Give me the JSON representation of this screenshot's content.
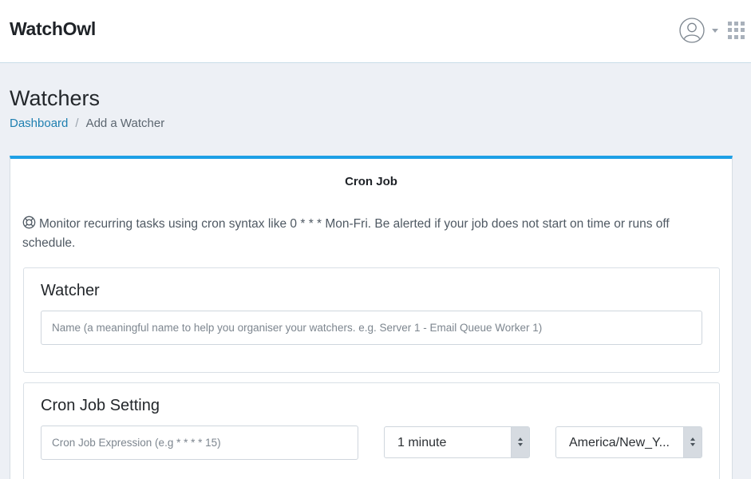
{
  "header": {
    "brand": "WatchOwl",
    "icons": [
      "user-avatar-icon",
      "caret-down-icon",
      "apps-grid-icon"
    ]
  },
  "page": {
    "title": "Watchers",
    "breadcrumb": {
      "home": "Dashboard",
      "separator": "/",
      "current": "Add a Watcher"
    }
  },
  "card": {
    "title": "Cron Job",
    "accent_color": "#1ea0e6",
    "intro_icon": "lifebuoy-icon",
    "intro": "Monitor recurring tasks using cron syntax like 0 * * * Mon-Fri. Be alerted if your job does not start on time or runs off schedule."
  },
  "watcher_panel": {
    "heading": "Watcher",
    "name_placeholder": "Name (a meaningful name to help you organiser your watchers. e.g. Server 1 - Email Queue Worker 1)"
  },
  "cron_panel": {
    "heading": "Cron Job Setting",
    "expression_placeholder": "Cron Job Expression (e.g * * * * 15)",
    "interval_value": "1 minute",
    "timezone_value": "America/New_Y..."
  }
}
